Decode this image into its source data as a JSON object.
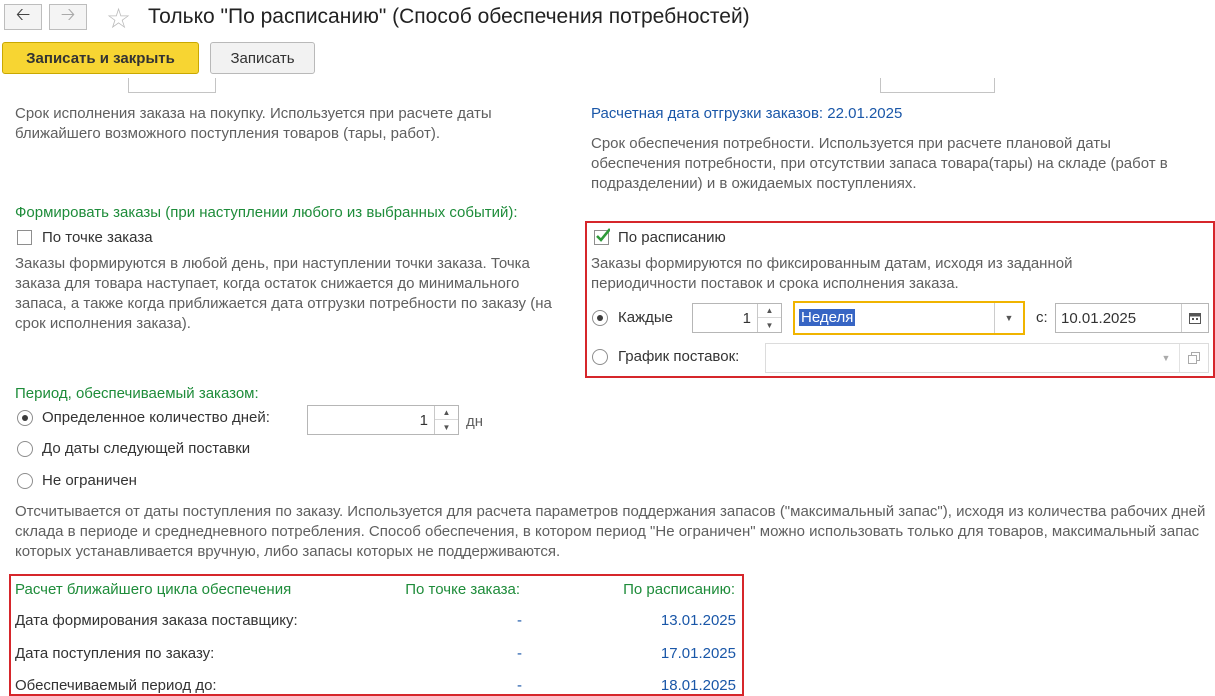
{
  "window": {
    "title": "Только \"По расписанию\" (Способ обеспечения потребностей)"
  },
  "toolbar": {
    "save_close_label": "Записать и закрыть",
    "save_label": "Записать"
  },
  "left_top": {
    "order_term_desc": "Срок исполнения заказа на покупку. Используется при расчете даты ближайшего возможного поступления товаров (тары, работ)."
  },
  "right_top": {
    "shipment_date_label": "Расчетная дата отгрузки заказов: 22.01.2025",
    "supply_term_desc": "Срок обеспечения потребности. Используется при расчете плановой даты обеспечения потребности, при отсутствии запаса товара(тары) на складе (работ в подразделении) и в ожидаемых поступлениях."
  },
  "form_orders": {
    "heading": "Формировать заказы (при наступлении любого из выбранных событий):",
    "by_order_point": {
      "label": "По точке заказа",
      "checked": false,
      "desc": "Заказы формируются в любой день, при наступлении точки заказа. Точка заказа для товара  наступает, когда остаток снижается до минимального запаса, а также когда приближается дата отгрузки потребности по заказу (на срок исполнения заказа)."
    },
    "by_schedule": {
      "label": "По расписанию",
      "checked": true,
      "desc": "Заказы формируются по фиксированным датам, исходя из заданной периодичности поставок и срока исполнения заказа.",
      "every_label": "Каждые",
      "every_value": "1",
      "period_value": "Неделя",
      "from_label": "с:",
      "from_date": "10.01.2025",
      "schedule_label": "График поставок:",
      "schedule_value": ""
    }
  },
  "period": {
    "heading": "Период, обеспечиваемый заказом:",
    "options": [
      {
        "label": "Определенное количество дней:",
        "selected": true
      },
      {
        "label": "До даты следующей поставки",
        "selected": false
      },
      {
        "label": "Не ограничен",
        "selected": false
      }
    ],
    "days_value": "1",
    "days_unit": "дн",
    "desc": "Отсчитывается от даты поступления по заказу. Используется для расчета параметров поддержания запасов (\"максимальный запас\"), исходя из количества рабочих дней склада в периоде и среднедневного потребления. Способ обеспечения, в котором период \"Не ограничен\" можно использовать только для товаров, максимальный запас которых устанавливается вручную, либо запасы которых не поддерживаются."
  },
  "calc_table": {
    "headers": [
      "Расчет ближайшего цикла обеспечения",
      "По точке заказа:",
      "По расписанию:"
    ],
    "rows": [
      [
        "Дата формирования заказа поставщику:",
        "-",
        "13.01.2025"
      ],
      [
        "Дата поступления по заказу:",
        "-",
        "17.01.2025"
      ],
      [
        "Обеспечиваемый период до:",
        "-",
        "18.01.2025"
      ]
    ]
  },
  "colors": {
    "accent_yellow": "#f7d532",
    "green": "#1e8c3a",
    "blue": "#1a57a8",
    "highlight_red": "#d6262b",
    "focus_orange": "#f0b400"
  }
}
